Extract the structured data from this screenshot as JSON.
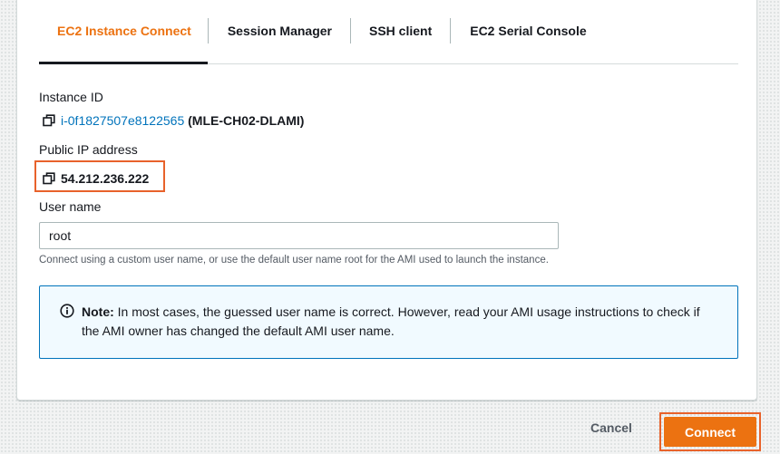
{
  "tabs": [
    {
      "label": "EC2 Instance Connect",
      "active": true
    },
    {
      "label": "Session Manager",
      "active": false
    },
    {
      "label": "SSH client",
      "active": false
    },
    {
      "label": "EC2 Serial Console",
      "active": false
    }
  ],
  "instance": {
    "label": "Instance ID",
    "id": "i-0f1827507e8122565",
    "name": "(MLE-CH02-DLAMI)"
  },
  "public_ip": {
    "label": "Public IP address",
    "value": "54.212.236.222"
  },
  "user_name": {
    "label": "User name",
    "value": "root",
    "hint": "Connect using a custom user name, or use the default user name root for the AMI used to launch the instance."
  },
  "note": {
    "title": "Note:",
    "text": " In most cases, the guessed user name is correct. However, read your AMI usage instructions to check if the AMI owner has changed the default AMI user name."
  },
  "actions": {
    "cancel": "Cancel",
    "connect": "Connect"
  },
  "icons": {
    "copy": "copy-icon",
    "info": "info-icon"
  },
  "colors": {
    "accent": "#ec7211",
    "highlight": "#e8622b",
    "link": "#0073bb",
    "alert_bg": "#f1faff"
  }
}
